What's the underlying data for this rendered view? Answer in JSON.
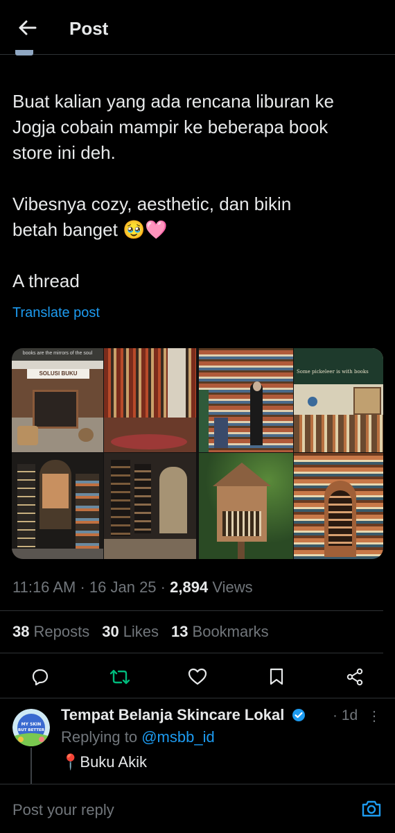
{
  "header": {
    "title": "Post"
  },
  "post": {
    "body": "Buat kalian yang ada rencana liburan ke\nJogja cobain mampir ke beberapa book\nstore ini deh.\n\nVibesnya cozy, aesthetic, dan bikin\nbetah banget 🥹🩷\n\nA thread",
    "translate_label": "Translate post",
    "images": [
      {
        "sign_top": "books are the mirrors of the soul",
        "sign_name": "SOLUSI BUKU"
      },
      {
        "sign_top": ""
      },
      {
        "sign_top": ""
      },
      {
        "sign_top": ""
      },
      {
        "sign_top": ""
      },
      {
        "sign_top": "Some pickeleer is with books"
      },
      {
        "sign_top": ""
      },
      {
        "sign_top": ""
      }
    ],
    "time": "11:16 AM",
    "date": "16 Jan 25",
    "views_count": "2,894",
    "views_label": "Views",
    "sep": "·",
    "stats": {
      "reposts_count": "38",
      "reposts_label": "Reposts",
      "likes_count": "30",
      "likes_label": "Likes",
      "bookmarks_count": "13",
      "bookmarks_label": "Bookmarks"
    }
  },
  "reply": {
    "author": "Tempat Belanja Skincare Lokal",
    "time": "· 1d",
    "more": "⋮",
    "replying_prefix": "Replying to",
    "replying_handle": "@msbb_id",
    "text": "📍Buku Akik",
    "avatar_text": "MY SKIN BUT BETTER"
  },
  "composer": {
    "placeholder": "Post your reply"
  },
  "colors": {
    "accent": "#1d9bf0",
    "repost": "#00ba7c",
    "muted": "#71767b",
    "verified": "#1d9bf0"
  }
}
